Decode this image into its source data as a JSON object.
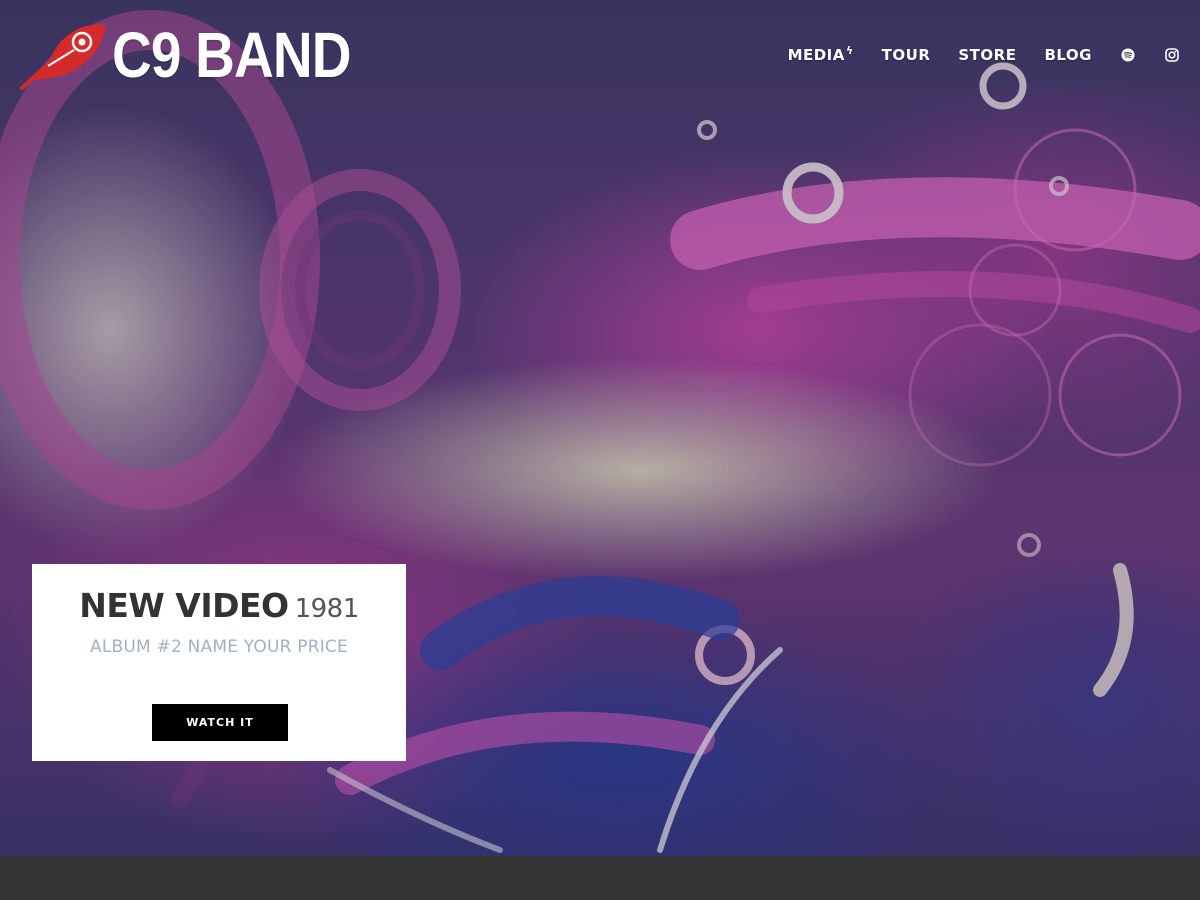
{
  "brand": {
    "name": "C9 BAND",
    "logo_icon": "feather-icon",
    "logo_color": "#d42a2a"
  },
  "nav": {
    "items": [
      {
        "label": "MEDIA",
        "suffix": "ϟ"
      },
      {
        "label": "TOUR"
      },
      {
        "label": "STORE"
      },
      {
        "label": "BLOG"
      }
    ],
    "icons": [
      "spotify-icon",
      "instagram-icon"
    ]
  },
  "feature": {
    "title": "NEW VIDEO",
    "year": "1981",
    "subtitle": "ALBUM #2 NAME YOUR PRICE",
    "button_label": "WATCH IT"
  },
  "colors": {
    "footer_band": "#353535",
    "button_bg": "#000000",
    "subtitle": "#9fb2c4"
  }
}
